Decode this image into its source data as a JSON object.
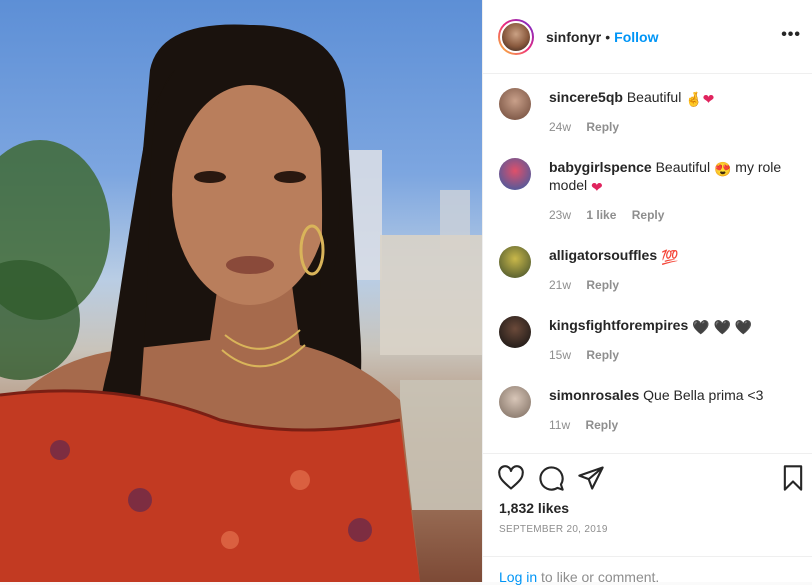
{
  "post": {
    "username": "sinfonyr",
    "separator": "•",
    "follow_label": "Follow",
    "more_label": "•••"
  },
  "comments": [
    {
      "user": "sincere5qb",
      "text": "Beautiful",
      "emoji": [
        "🤞",
        "❤"
      ],
      "age": "24w",
      "likes": "",
      "reply": "Reply",
      "avatar_color": "#8a6a5a"
    },
    {
      "user": "babygirlspence",
      "text": "Beautiful",
      "emoji_mid": "😍",
      "text_after": "my role model",
      "emoji_end": "❤",
      "age": "23w",
      "likes": "1 like",
      "reply": "Reply",
      "avatar_color": "#2d5ca8"
    },
    {
      "user": "alligatorsouffles",
      "text": "",
      "emoji": [
        "💯"
      ],
      "age": "21w",
      "likes": "",
      "reply": "Reply",
      "avatar_color": "#3c4a2a"
    },
    {
      "user": "kingsfightforempires",
      "text": "",
      "emoji": [
        "🖤",
        "🖤",
        "🖤"
      ],
      "age": "15w",
      "likes": "",
      "reply": "Reply",
      "avatar_color": "#1b1b1b"
    },
    {
      "user": "simonrosales",
      "text": "Que Bella prima <3",
      "emoji": [],
      "age": "11w",
      "likes": "",
      "reply": "Reply",
      "avatar_color": "#b7a79a"
    }
  ],
  "actions": {
    "likes": "1,832 likes",
    "date": "SEPTEMBER 20, 2019",
    "login_link": "Log in",
    "login_rest": " to like or comment."
  },
  "icons": {
    "like": "heart-outline-icon",
    "comment": "comment-bubble-icon",
    "share": "paper-plane-icon",
    "save": "bookmark-icon"
  },
  "colors": {
    "link": "#0095f6",
    "muted": "#8e8e8e",
    "text": "#262626"
  }
}
